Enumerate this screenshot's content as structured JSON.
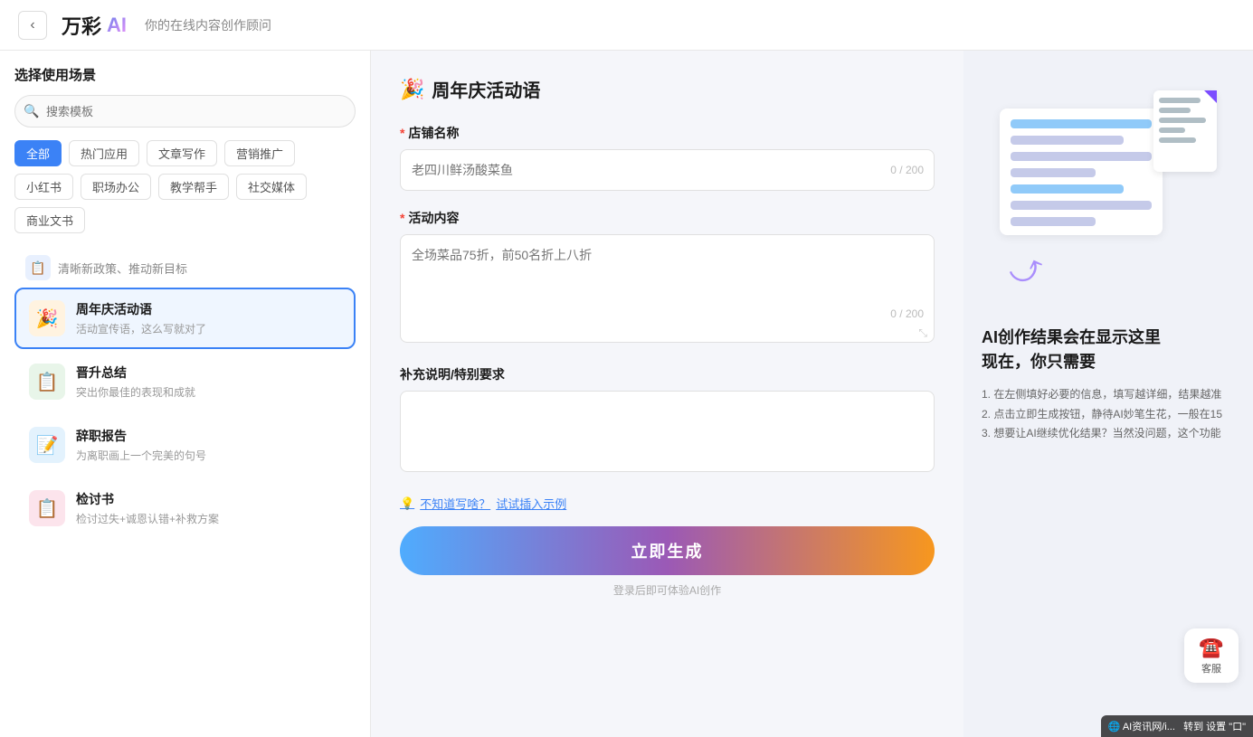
{
  "header": {
    "back_label": "‹",
    "logo_text": "万彩",
    "logo_ai": "AI",
    "subtitle": "你的在线内容创作顾问"
  },
  "sidebar": {
    "title": "选择使用场景",
    "search_placeholder": "搜索模板",
    "filter_tags": [
      {
        "label": "全部",
        "active": true
      },
      {
        "label": "热门应用",
        "active": false
      },
      {
        "label": "文章写作",
        "active": false
      },
      {
        "label": "营销推广",
        "active": false
      },
      {
        "label": "小红书",
        "active": false
      },
      {
        "label": "职场办公",
        "active": false
      },
      {
        "label": "教学帮手",
        "active": false
      },
      {
        "label": "社交媒体",
        "active": false
      },
      {
        "label": "商业文书",
        "active": false
      }
    ],
    "section_hint": "清晰新政策、推动新目标",
    "templates": [
      {
        "id": "party",
        "icon": "🎉",
        "icon_bg": "party",
        "name": "周年庆活动语",
        "desc": "活动宣传语，这么写就对了",
        "active": true
      },
      {
        "id": "promote",
        "icon": "📋",
        "icon_bg": "promote",
        "name": "晋升总结",
        "desc": "突出你最佳的表现和成就",
        "active": false
      },
      {
        "id": "resign",
        "icon": "📝",
        "icon_bg": "resign",
        "name": "辞职报告",
        "desc": "为离职画上一个完美的句号",
        "active": false
      },
      {
        "id": "review",
        "icon": "📋",
        "icon_bg": "review",
        "name": "检讨书",
        "desc": "检讨过失+诚恩认错+补救方案",
        "active": false
      }
    ]
  },
  "form": {
    "title_icon": "🎉",
    "title": "周年庆活动语",
    "fields": {
      "store_name": {
        "label": "店铺名称",
        "required": true,
        "placeholder": "老四川鲜汤酸菜鱼",
        "char_count": "0 / 200"
      },
      "activity_content": {
        "label": "活动内容",
        "required": true,
        "placeholder": "全场菜品75折，前50名折上八折",
        "char_count": "0 / 200"
      },
      "supplement": {
        "label": "补充说明/特别要求",
        "required": false,
        "placeholder": ""
      }
    },
    "hint_text": "不知道写啥？试试插入示例",
    "hint_icon": "💡",
    "hint_link_text": "试试插入示例",
    "generate_btn": "立即生成",
    "login_hint": "登录后即可体验AI创作"
  },
  "preview": {
    "title": "AI创作结果会在显示这里\n现在，你只需要",
    "steps": [
      "1. 在左侧填好必要的信息，填写越详细，结果越准",
      "2. 点击立即生成按钮，静待AI妙笔生花，一般在15",
      "3. 想要让AI继续优化结果？当然没问题，这个功能"
    ]
  },
  "customer_service": {
    "label": "客服",
    "icon": "☎"
  },
  "ai_badge": "AI资讯网/i...\n转到 设置\"口"
}
